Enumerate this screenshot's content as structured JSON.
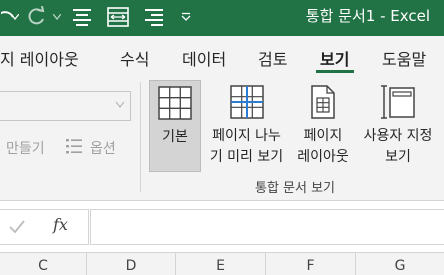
{
  "title_bar": {
    "title": "통합 문서1  -  Excel",
    "background": "#217346",
    "qat": [
      {
        "icon": "undo-icon"
      },
      {
        "icon": "dropdown-arrow-icon"
      },
      {
        "icon": "redo-icon"
      },
      {
        "icon": "dropdown-arrow-icon"
      },
      {
        "icon": "align-center-icon"
      },
      {
        "icon": "fit-width-icon"
      },
      {
        "icon": "align-right-icon"
      },
      {
        "icon": "customize-qat-icon"
      }
    ]
  },
  "ribbon_tabs": {
    "items": [
      {
        "label": "지 레이아웃"
      },
      {
        "label": "수식"
      },
      {
        "label": "데이터"
      },
      {
        "label": "검토"
      },
      {
        "label": "보기",
        "active": true
      },
      {
        "label": "도움말"
      }
    ],
    "accent": "#217346"
  },
  "ribbon": {
    "prev_group": {
      "make_label": "만들기",
      "options_label": "옵션",
      "options_icon": "list-icon"
    },
    "workbook_views": {
      "group_label": "통합 문서 보기",
      "buttons": [
        {
          "label": "기본",
          "icon": "normal-view-icon",
          "selected": true
        },
        {
          "label": "페이지 나누\n기 미리 보기",
          "icon": "page-break-preview-icon"
        },
        {
          "label": "페이지\n레이아웃",
          "icon": "page-layout-icon"
        },
        {
          "label": "사용자 지정\n보기",
          "icon": "custom-views-icon"
        }
      ]
    }
  },
  "formula_bar": {
    "enter_icon": "check-icon",
    "function_label": "fx",
    "value": ""
  },
  "column_headers": [
    "C",
    "D",
    "E",
    "F",
    "G"
  ]
}
